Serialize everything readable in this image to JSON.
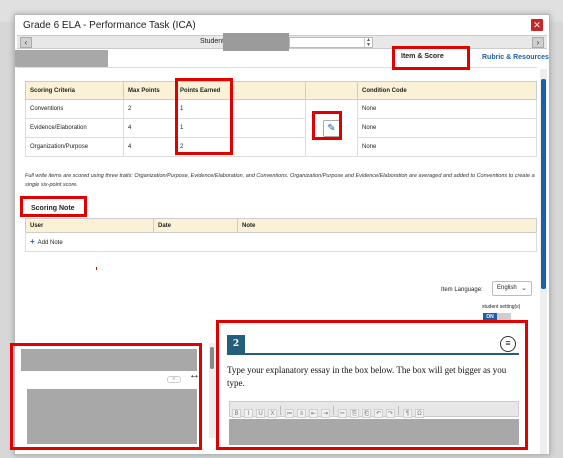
{
  "modal": {
    "title": "Grade 6 ELA - Performance Task (ICA)",
    "close_glyph": "✕"
  },
  "student_bar": {
    "label": "Student:",
    "prev_glyph": "‹",
    "next_glyph": "›",
    "spin_up": "▲",
    "spin_down": "▼"
  },
  "tabs": [
    {
      "label": "Item & Score",
      "active": true
    },
    {
      "label": "Rubric & Resources",
      "active": false
    }
  ],
  "score_table": {
    "headers": [
      "Scoring Criteria",
      "Max Points",
      "Points Earned",
      "",
      "Condition Code"
    ],
    "rows": [
      {
        "criteria": "Conventions",
        "max": "2",
        "earned": "1",
        "condition": "None"
      },
      {
        "criteria": "Evidence/Elaboration",
        "max": "4",
        "earned": "1",
        "condition": "None"
      },
      {
        "criteria": "Organization/Purpose",
        "max": "4",
        "earned": "2",
        "condition": "None"
      }
    ],
    "edit_icon": "pencil-icon"
  },
  "help_text": "Full write items are scored using three traits: Organization/Purpose, Evidence/Elaboration, and Conventions. Organization/Purpose and Evidence/Elaboration are averaged and added to Conventions to create a single six-point score.",
  "scoring_note": {
    "header": "Scoring Note",
    "columns": [
      "User",
      "Date",
      "Note"
    ],
    "add_label": "Add Note",
    "plus_glyph": "+"
  },
  "language": {
    "label": "Item Language:",
    "value": "English",
    "chevron": "⌄"
  },
  "student_settings": {
    "label": "student setting(s)",
    "toggle_label": "ON"
  },
  "question": {
    "number": "2",
    "menu_glyph": "≡",
    "prompt": "Type your explanatory essay in the box below. The box will get bigger as you type.",
    "toolbar": [
      "B",
      "I",
      "U",
      "X",
      "≔",
      "≡",
      "⇤",
      "⇥",
      "✂",
      "⎘",
      "⎗",
      "↶",
      "↷",
      "¶",
      "Ω"
    ]
  },
  "resize_glyph": "↔",
  "mini_menu_glyph": "≡",
  "colors": {
    "accent": "#1b5fa8",
    "header_bg": "#faf1d6",
    "question_accent": "#215f7d",
    "highlight": "#e00000",
    "close": "#c62828"
  }
}
